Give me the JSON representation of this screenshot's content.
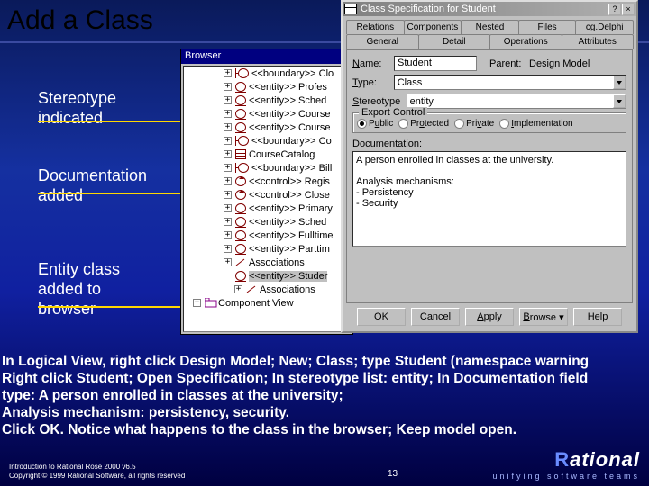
{
  "slide": {
    "title": "Add a Class",
    "annotations": {
      "a1": "Stereotype\nindicated",
      "a2": "Documentation\nadded",
      "a3": "Entity class\nadded to\nbrowser"
    },
    "body": "In Logical View, right click Design Model;  New;  Class;  type Student (namespace warning\nRight click Student;  Open Specification;  In stereotype list:  entity;  In Documentation field\n type:  A person enrolled in classes at the university;\n Analysis mechanism:  persistency, security.\nClick OK.  Notice what happens to the class in the browser;  Keep model open.",
    "footer1": "Introduction to Rational Rose 2000 v6.5",
    "footer2": "Copyright © 1999 Rational Software, all rights reserved",
    "pagenum": "13",
    "logo_word_prefix": "R",
    "logo_word_rest": "ational",
    "logo_tag": "unifying software teams"
  },
  "browser": {
    "title": "Browser",
    "items": [
      {
        "icon": "boundary",
        "label": "<<boundary>> Clo",
        "plus": "+"
      },
      {
        "icon": "entity",
        "label": "<<entity>> Profes",
        "plus": "+"
      },
      {
        "icon": "entity",
        "label": "<<entity>> Sched",
        "plus": "+"
      },
      {
        "icon": "entity",
        "label": "<<entity>> Course",
        "plus": "+"
      },
      {
        "icon": "entity",
        "label": "<<entity>> Course",
        "plus": "+"
      },
      {
        "icon": "boundary",
        "label": "<<boundary>> Co",
        "plus": "+"
      },
      {
        "icon": "class",
        "label": "CourseCatalog",
        "plus": "+"
      },
      {
        "icon": "boundary",
        "label": "<<boundary>> Bill",
        "plus": "+"
      },
      {
        "icon": "control",
        "label": "<<control>> Regis",
        "plus": "+"
      },
      {
        "icon": "control",
        "label": "<<control>> Close",
        "plus": "+"
      },
      {
        "icon": "entity",
        "label": "<<entity>> Primary",
        "plus": "+"
      },
      {
        "icon": "entity",
        "label": "<<entity>> Sched",
        "plus": "+"
      },
      {
        "icon": "entity",
        "label": "<<entity>> Fulltime",
        "plus": "+"
      },
      {
        "icon": "entity",
        "label": "<<entity>> Parttim",
        "plus": "+"
      },
      {
        "icon": "assoc",
        "label": "Associations",
        "plus": "+"
      },
      {
        "icon": "entity",
        "label": "<<entity>> Studer",
        "plus": "",
        "sel": true
      },
      {
        "icon": "assoc",
        "label": "Associations",
        "plus": "+",
        "indent": "lvl2"
      },
      {
        "icon": "pkg",
        "label": "Component View",
        "plus": "+",
        "indent": "root"
      }
    ]
  },
  "spec": {
    "title": "Class Specification for Student",
    "help_btn": "?",
    "close_btn": "×",
    "tabs_back": [
      "Relations",
      "Components",
      "Nested",
      "Files",
      "cg.Delphi"
    ],
    "tabs_front": [
      "General",
      "Detail",
      "Operations",
      "Attributes"
    ],
    "active_tab": "General",
    "name_label": "Name:",
    "name_value": "Student",
    "parent_label": "Parent:",
    "parent_value": "Design Model",
    "type_label": "Type:",
    "type_value": "Class",
    "stereo_label": "Stereotype",
    "stereo_value": "entity",
    "export_group": "Export Control",
    "radios": [
      {
        "label": "Public",
        "checked": true,
        "u": "u"
      },
      {
        "label": "Protected",
        "checked": false,
        "u": "o"
      },
      {
        "label": "Private",
        "checked": false,
        "u": "v"
      },
      {
        "label": "Implementation",
        "checked": false,
        "u": "I"
      }
    ],
    "doc_label": "Documentation:",
    "doc_text": "A person enrolled in classes at the university.\n\nAnalysis mechanisms:\n- Persistency\n- Security",
    "buttons": {
      "ok": "OK",
      "cancel": "Cancel",
      "apply": "Apply",
      "browse": "Browse",
      "help": "Help"
    }
  }
}
